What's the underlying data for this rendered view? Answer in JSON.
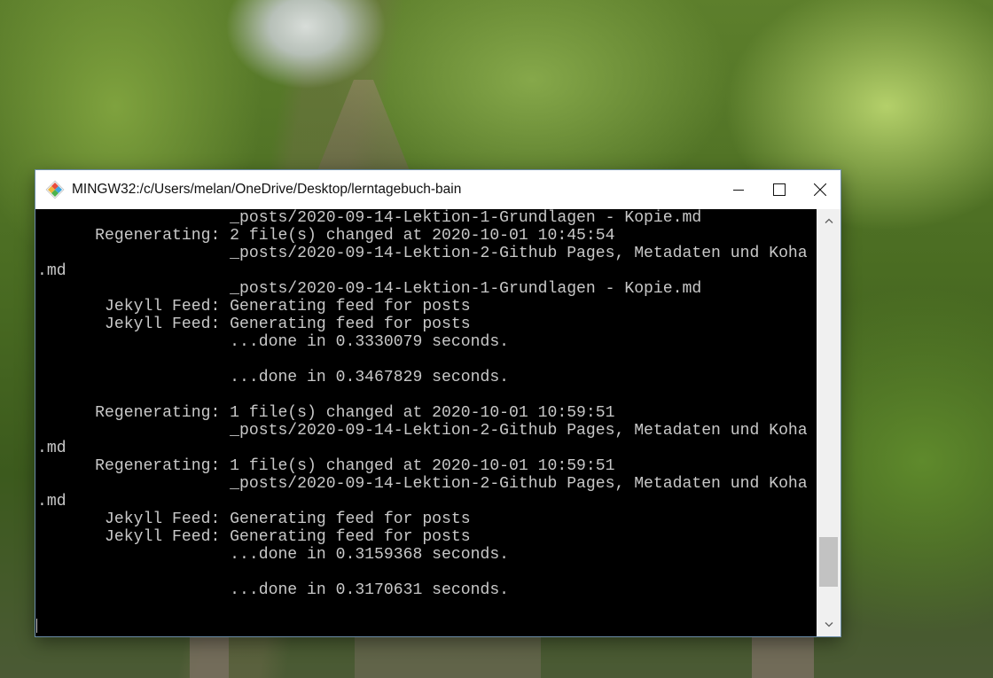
{
  "window": {
    "title": "MINGW32:/c/Users/melan/OneDrive/Desktop/lerntagebuch-bain",
    "controls": {
      "minimize_icon": "minimize-icon",
      "maximize_icon": "maximize-icon",
      "close_icon": "close-icon"
    }
  },
  "terminal": {
    "lines": [
      "                    _posts/2020-09-14-Lektion-1-Grundlagen - Kopie.md",
      "      Regenerating: 2 file(s) changed at 2020-10-01 10:45:54",
      "                    _posts/2020-09-14-Lektion-2-Github Pages, Metadaten und Koha",
      ".md",
      "                    _posts/2020-09-14-Lektion-1-Grundlagen - Kopie.md",
      "       Jekyll Feed: Generating feed for posts",
      "       Jekyll Feed: Generating feed for posts",
      "                    ...done in 0.3330079 seconds.",
      "",
      "                    ...done in 0.3467829 seconds.",
      "",
      "      Regenerating: 1 file(s) changed at 2020-10-01 10:59:51",
      "                    _posts/2020-09-14-Lektion-2-Github Pages, Metadaten und Koha",
      ".md",
      "      Regenerating: 1 file(s) changed at 2020-10-01 10:59:51",
      "                    _posts/2020-09-14-Lektion-2-Github Pages, Metadaten und Koha",
      ".md",
      "       Jekyll Feed: Generating feed for posts",
      "       Jekyll Feed: Generating feed for posts",
      "                    ...done in 0.3159368 seconds.",
      "",
      "                    ...done in 0.3170631 seconds.",
      "",
      ""
    ],
    "scroll_position": 0.92
  },
  "colors": {
    "terminal_bg": "#000000",
    "terminal_fg": "#c8c8c8",
    "titlebar_bg": "#ffffff"
  }
}
